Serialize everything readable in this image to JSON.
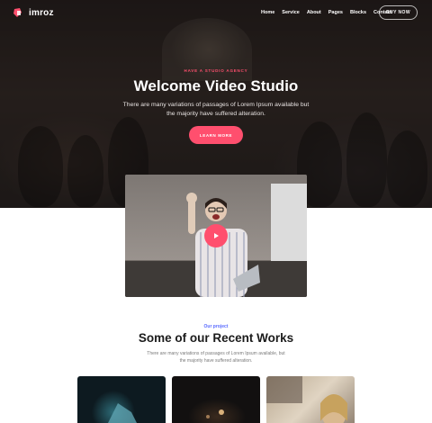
{
  "brand": {
    "name": "imroz",
    "accent": "#ff4f6e"
  },
  "nav": {
    "items": [
      "Home",
      "Service",
      "About",
      "Pages",
      "Blocks",
      "Contact"
    ],
    "cta": "BUY NOW"
  },
  "hero": {
    "eyebrow": "HAVE A STUDIO AGENCY",
    "title": "Welcome Video Studio",
    "subtitle": "There are many variations of passages of Lorem Ipsum available but the majority have suffered alteration.",
    "button": "LEARN MORE"
  },
  "video": {
    "play_icon": "play-icon"
  },
  "works": {
    "eyebrow": "Our project",
    "title": "Some of our Recent Works",
    "subtitle": "There are many variations of passages of Lorem Ipsum available, but the majority have suffered alteration."
  }
}
